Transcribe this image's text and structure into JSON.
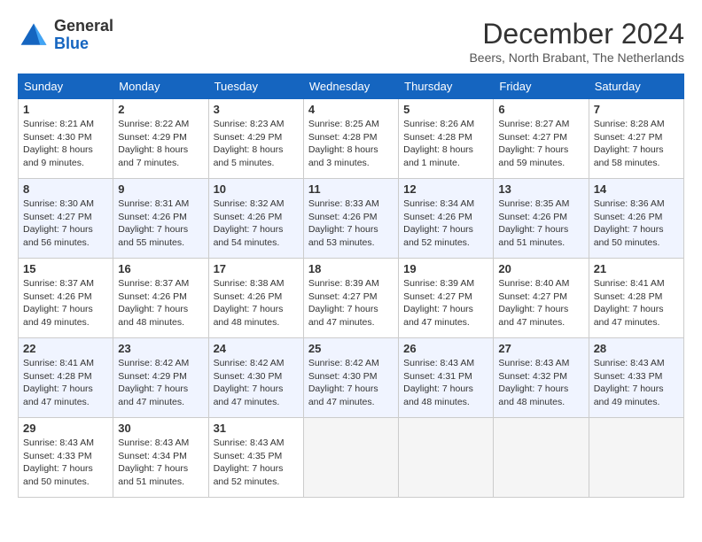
{
  "header": {
    "logo_line1": "General",
    "logo_line2": "Blue",
    "month_title": "December 2024",
    "location": "Beers, North Brabant, The Netherlands"
  },
  "weekdays": [
    "Sunday",
    "Monday",
    "Tuesday",
    "Wednesday",
    "Thursday",
    "Friday",
    "Saturday"
  ],
  "weeks": [
    [
      {
        "day": "1",
        "sunrise": "Sunrise: 8:21 AM",
        "sunset": "Sunset: 4:30 PM",
        "daylight": "Daylight: 8 hours and 9 minutes."
      },
      {
        "day": "2",
        "sunrise": "Sunrise: 8:22 AM",
        "sunset": "Sunset: 4:29 PM",
        "daylight": "Daylight: 8 hours and 7 minutes."
      },
      {
        "day": "3",
        "sunrise": "Sunrise: 8:23 AM",
        "sunset": "Sunset: 4:29 PM",
        "daylight": "Daylight: 8 hours and 5 minutes."
      },
      {
        "day": "4",
        "sunrise": "Sunrise: 8:25 AM",
        "sunset": "Sunset: 4:28 PM",
        "daylight": "Daylight: 8 hours and 3 minutes."
      },
      {
        "day": "5",
        "sunrise": "Sunrise: 8:26 AM",
        "sunset": "Sunset: 4:28 PM",
        "daylight": "Daylight: 8 hours and 1 minute."
      },
      {
        "day": "6",
        "sunrise": "Sunrise: 8:27 AM",
        "sunset": "Sunset: 4:27 PM",
        "daylight": "Daylight: 7 hours and 59 minutes."
      },
      {
        "day": "7",
        "sunrise": "Sunrise: 8:28 AM",
        "sunset": "Sunset: 4:27 PM",
        "daylight": "Daylight: 7 hours and 58 minutes."
      }
    ],
    [
      {
        "day": "8",
        "sunrise": "Sunrise: 8:30 AM",
        "sunset": "Sunset: 4:27 PM",
        "daylight": "Daylight: 7 hours and 56 minutes."
      },
      {
        "day": "9",
        "sunrise": "Sunrise: 8:31 AM",
        "sunset": "Sunset: 4:26 PM",
        "daylight": "Daylight: 7 hours and 55 minutes."
      },
      {
        "day": "10",
        "sunrise": "Sunrise: 8:32 AM",
        "sunset": "Sunset: 4:26 PM",
        "daylight": "Daylight: 7 hours and 54 minutes."
      },
      {
        "day": "11",
        "sunrise": "Sunrise: 8:33 AM",
        "sunset": "Sunset: 4:26 PM",
        "daylight": "Daylight: 7 hours and 53 minutes."
      },
      {
        "day": "12",
        "sunrise": "Sunrise: 8:34 AM",
        "sunset": "Sunset: 4:26 PM",
        "daylight": "Daylight: 7 hours and 52 minutes."
      },
      {
        "day": "13",
        "sunrise": "Sunrise: 8:35 AM",
        "sunset": "Sunset: 4:26 PM",
        "daylight": "Daylight: 7 hours and 51 minutes."
      },
      {
        "day": "14",
        "sunrise": "Sunrise: 8:36 AM",
        "sunset": "Sunset: 4:26 PM",
        "daylight": "Daylight: 7 hours and 50 minutes."
      }
    ],
    [
      {
        "day": "15",
        "sunrise": "Sunrise: 8:37 AM",
        "sunset": "Sunset: 4:26 PM",
        "daylight": "Daylight: 7 hours and 49 minutes."
      },
      {
        "day": "16",
        "sunrise": "Sunrise: 8:37 AM",
        "sunset": "Sunset: 4:26 PM",
        "daylight": "Daylight: 7 hours and 48 minutes."
      },
      {
        "day": "17",
        "sunrise": "Sunrise: 8:38 AM",
        "sunset": "Sunset: 4:26 PM",
        "daylight": "Daylight: 7 hours and 48 minutes."
      },
      {
        "day": "18",
        "sunrise": "Sunrise: 8:39 AM",
        "sunset": "Sunset: 4:27 PM",
        "daylight": "Daylight: 7 hours and 47 minutes."
      },
      {
        "day": "19",
        "sunrise": "Sunrise: 8:39 AM",
        "sunset": "Sunset: 4:27 PM",
        "daylight": "Daylight: 7 hours and 47 minutes."
      },
      {
        "day": "20",
        "sunrise": "Sunrise: 8:40 AM",
        "sunset": "Sunset: 4:27 PM",
        "daylight": "Daylight: 7 hours and 47 minutes."
      },
      {
        "day": "21",
        "sunrise": "Sunrise: 8:41 AM",
        "sunset": "Sunset: 4:28 PM",
        "daylight": "Daylight: 7 hours and 47 minutes."
      }
    ],
    [
      {
        "day": "22",
        "sunrise": "Sunrise: 8:41 AM",
        "sunset": "Sunset: 4:28 PM",
        "daylight": "Daylight: 7 hours and 47 minutes."
      },
      {
        "day": "23",
        "sunrise": "Sunrise: 8:42 AM",
        "sunset": "Sunset: 4:29 PM",
        "daylight": "Daylight: 7 hours and 47 minutes."
      },
      {
        "day": "24",
        "sunrise": "Sunrise: 8:42 AM",
        "sunset": "Sunset: 4:30 PM",
        "daylight": "Daylight: 7 hours and 47 minutes."
      },
      {
        "day": "25",
        "sunrise": "Sunrise: 8:42 AM",
        "sunset": "Sunset: 4:30 PM",
        "daylight": "Daylight: 7 hours and 47 minutes."
      },
      {
        "day": "26",
        "sunrise": "Sunrise: 8:43 AM",
        "sunset": "Sunset: 4:31 PM",
        "daylight": "Daylight: 7 hours and 48 minutes."
      },
      {
        "day": "27",
        "sunrise": "Sunrise: 8:43 AM",
        "sunset": "Sunset: 4:32 PM",
        "daylight": "Daylight: 7 hours and 48 minutes."
      },
      {
        "day": "28",
        "sunrise": "Sunrise: 8:43 AM",
        "sunset": "Sunset: 4:33 PM",
        "daylight": "Daylight: 7 hours and 49 minutes."
      }
    ],
    [
      {
        "day": "29",
        "sunrise": "Sunrise: 8:43 AM",
        "sunset": "Sunset: 4:33 PM",
        "daylight": "Daylight: 7 hours and 50 minutes."
      },
      {
        "day": "30",
        "sunrise": "Sunrise: 8:43 AM",
        "sunset": "Sunset: 4:34 PM",
        "daylight": "Daylight: 7 hours and 51 minutes."
      },
      {
        "day": "31",
        "sunrise": "Sunrise: 8:43 AM",
        "sunset": "Sunset: 4:35 PM",
        "daylight": "Daylight: 7 hours and 52 minutes."
      },
      null,
      null,
      null,
      null
    ]
  ]
}
